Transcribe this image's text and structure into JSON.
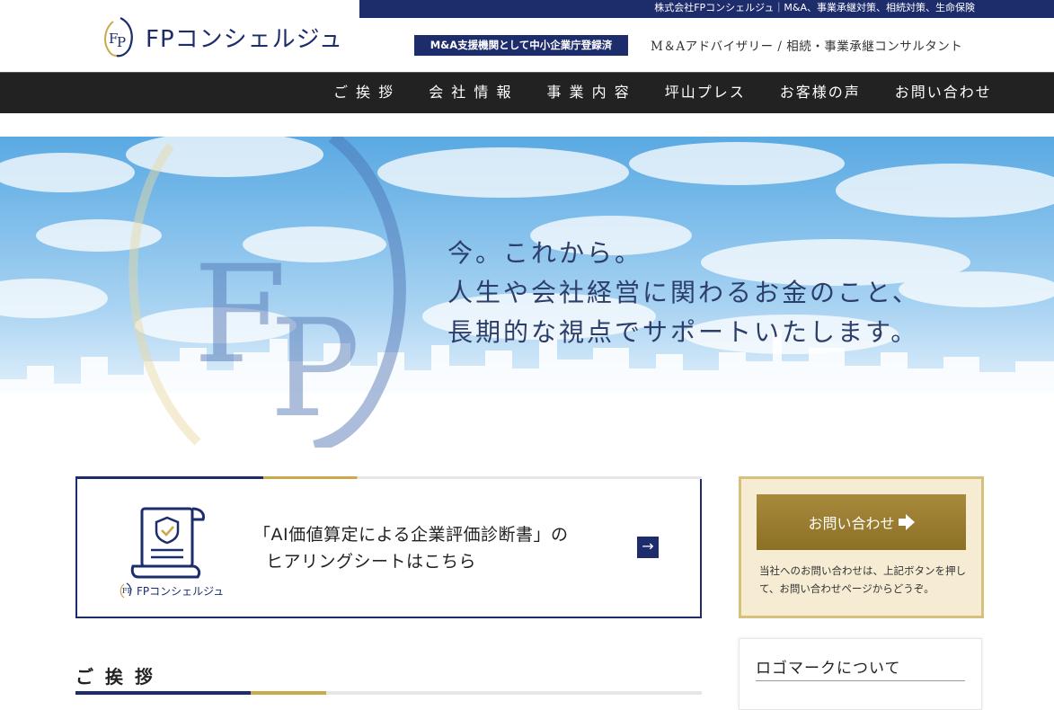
{
  "topbar": {
    "text": "株式会社FPコンシェルジュ｜M&A、事業承継対策、相続対策、生命保険"
  },
  "header": {
    "logo_text": "FPコンシェルジュ",
    "badge": "M&A支援機関として中小企業庁登録済",
    "tagline": "M＆Aアドバイザリー / 相続・事業承継コンサルタント"
  },
  "nav": {
    "items": [
      {
        "label": "ご 挨 拶"
      },
      {
        "label": "会 社 情 報"
      },
      {
        "label": "事 業 内 容"
      },
      {
        "label": "坪山プレス"
      },
      {
        "label": "お客様の声"
      },
      {
        "label": "お問い合わせ"
      }
    ]
  },
  "hero": {
    "lines": [
      "今。これから。",
      "人生や会社経営に関わるお金のこと、",
      "長期的な視点でサポートいたします。"
    ]
  },
  "card": {
    "line1": "「AI価値算定による企業評価診断書」の",
    "line2": "ヒアリングシートはこちら",
    "brand": "FPコンシェルジュ",
    "arrow": "→"
  },
  "contact": {
    "button_label": "お問い合わせ",
    "note": "当社へのお問い合わせは、上記ボタンを押して、お問い合わせページからどうぞ。"
  },
  "logomark": {
    "title": "ロゴマークについて"
  },
  "greeting": {
    "title": "ご 挨 拶"
  },
  "colors": {
    "navy": "#1d2c6b",
    "gold": "#a88a3c",
    "nav_bg": "#222222"
  }
}
